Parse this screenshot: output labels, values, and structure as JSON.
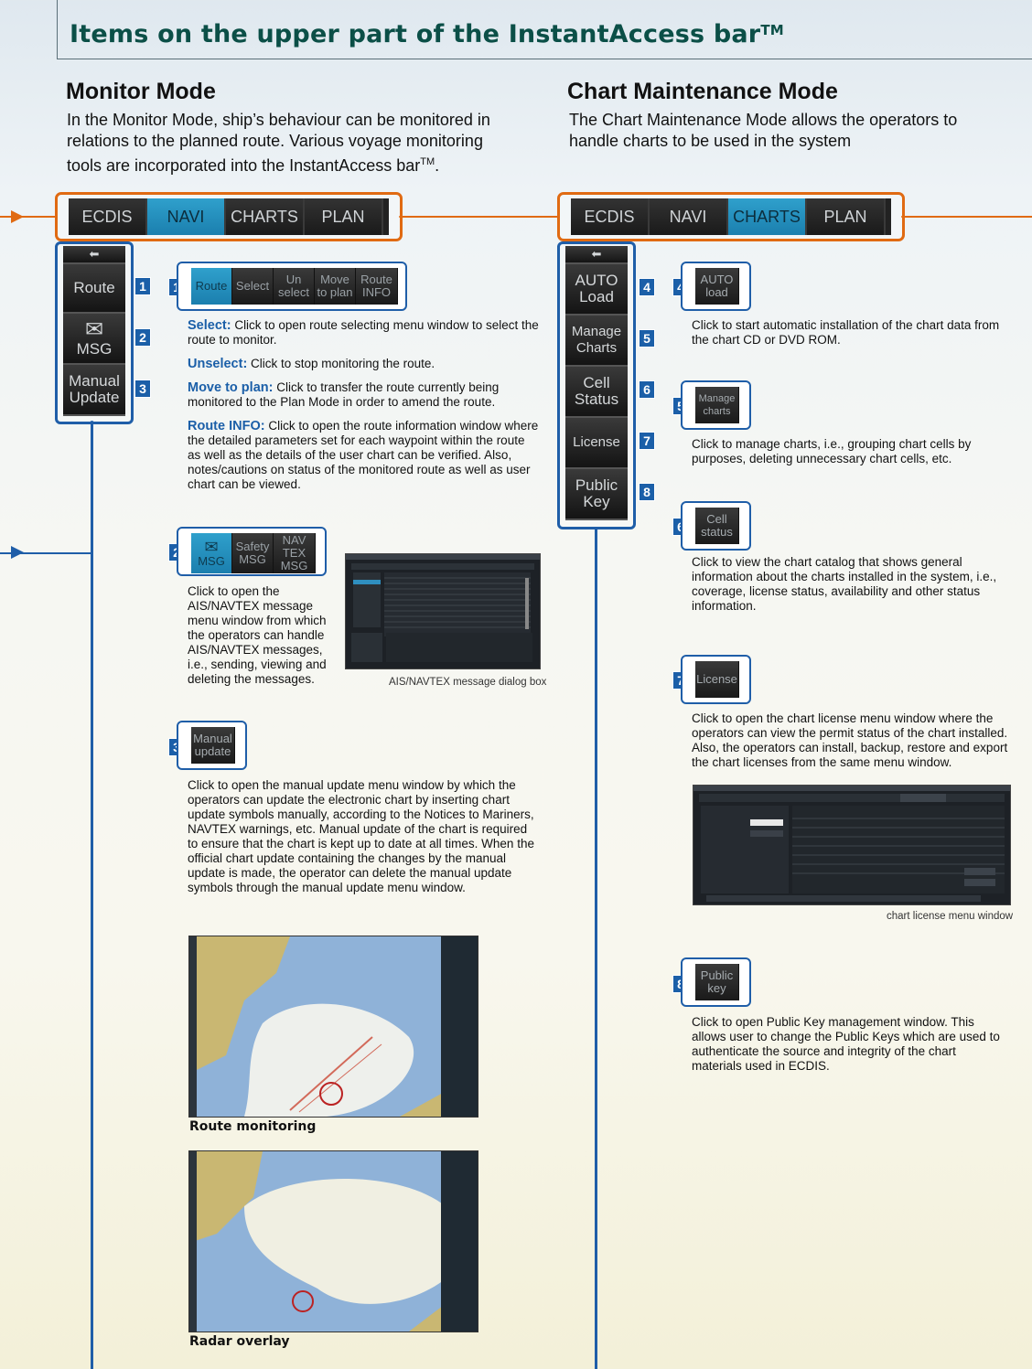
{
  "title": {
    "text": "Items on the upper part of the InstantAccess bar",
    "tm": "TM"
  },
  "monitor": {
    "heading": "Monitor Mode",
    "intro_1": "In the Monitor Mode, ship’s behaviour can be monitored in",
    "intro_2": "relations to the planned route. Various voyage monitoring",
    "intro_3": "tools are incorporated into the InstantAccess bar",
    "intro_tm": "TM",
    "intro_end": ".",
    "tabs": [
      "ECDIS",
      "NAVI",
      "CHARTS",
      "PLAN"
    ],
    "side_buttons": [
      {
        "label": "Route",
        "num": "1"
      },
      {
        "label": "MSG",
        "num": "2"
      },
      {
        "label_1": "Manual",
        "label_2": "Update",
        "num": "3"
      }
    ],
    "callout1": {
      "num": "1",
      "buttons": [
        "Route",
        "Select",
        "Un select",
        "Move to plan",
        "Route INFO"
      ],
      "items": [
        {
          "term": "Select:",
          "text": " Click to open route selecting menu window to select the route to monitor."
        },
        {
          "term": "Unselect:",
          "text": " Click to stop monitoring the route."
        },
        {
          "term": "Move to plan:",
          "text": " Click to transfer the route currently being monitored to the Plan Mode in order to amend the route."
        },
        {
          "term": "Route INFO:",
          "text": " Click to open the route information window where the detailed parameters set for each waypoint within the route as well as the details of the user chart can be verified. Also, notes/cautions on status of the monitored route as well as user chart can be viewed."
        }
      ]
    },
    "callout2": {
      "num": "2",
      "buttons": [
        "MSG",
        "Safety MSG",
        "NAV TEX MSG"
      ],
      "text": "Click to open the AIS/NAVTEX message menu window from which the operators can handle AIS/NAVTEX messages, i.e., sending, viewing and deleting the messages.",
      "caption": "AIS/NAVTEX message dialog box"
    },
    "callout3": {
      "num": "3",
      "button_1": "Manual",
      "button_2": "update",
      "text": "Click to open the manual update menu window by which the operators can update the electronic chart by inserting chart update symbols manually, according to the Notices to Mariners, NAVTEX warnings, etc. Manual update of the chart is required to ensure that the chart is kept up to date at all times. When the official chart update containing the changes by the manual update is made, the operator can delete the manual update symbols through the manual update menu window."
    },
    "map1_caption": "Route monitoring",
    "map2_caption": "Radar overlay"
  },
  "chart_maint": {
    "heading": "Chart Maintenance Mode",
    "intro_1": "The Chart Maintenance Mode allows the operators to",
    "intro_2": "handle charts to be used in the system",
    "tabs": [
      "ECDIS",
      "NAVI",
      "CHARTS",
      "PLAN"
    ],
    "side_buttons": [
      {
        "label_1": "AUTO",
        "label_2": "Load",
        "num": "4"
      },
      {
        "label_1": "Manage",
        "label_2": "Charts",
        "num": "5"
      },
      {
        "label_1": "Cell",
        "label_2": "Status",
        "num": "6"
      },
      {
        "label_1": "License",
        "label_2": "",
        "num": "7"
      },
      {
        "label_1": "Public",
        "label_2": "Key",
        "num": "8"
      }
    ],
    "callouts": [
      {
        "num": "4",
        "btn_1": "AUTO",
        "btn_2": "load",
        "text": "Click to start automatic installation of the chart data from the chart CD or DVD ROM."
      },
      {
        "num": "5",
        "btn_1": "Manage",
        "btn_2": "charts",
        "text": "Click to manage charts, i.e., grouping chart cells by purposes, deleting unnecessary chart cells, etc."
      },
      {
        "num": "6",
        "btn_1": "Cell",
        "btn_2": "status",
        "text": "Click to view the chart catalog that shows general information about the charts installed in the system, i.e., coverage, license status, availability and other status information."
      },
      {
        "num": "7",
        "btn_1": "License",
        "btn_2": "",
        "text": "Click to open the chart license menu window where the operators can view the permit status of the chart installed. Also, the operators can install, backup, restore and export the chart licenses from the same menu window."
      },
      {
        "num": "8",
        "btn_1": "Public",
        "btn_2": "key",
        "text": "Click to open Public Key management window. This allows user to change the Public Keys which are used to authenticate the source and integrity of the chart materials used in ECDIS."
      }
    ],
    "license_caption": "chart license menu window"
  },
  "colors": {
    "orange": "#e06a12",
    "blue": "#1f5ea8",
    "title_green": "#0b4f47",
    "active_tab": "#1b7fae"
  }
}
